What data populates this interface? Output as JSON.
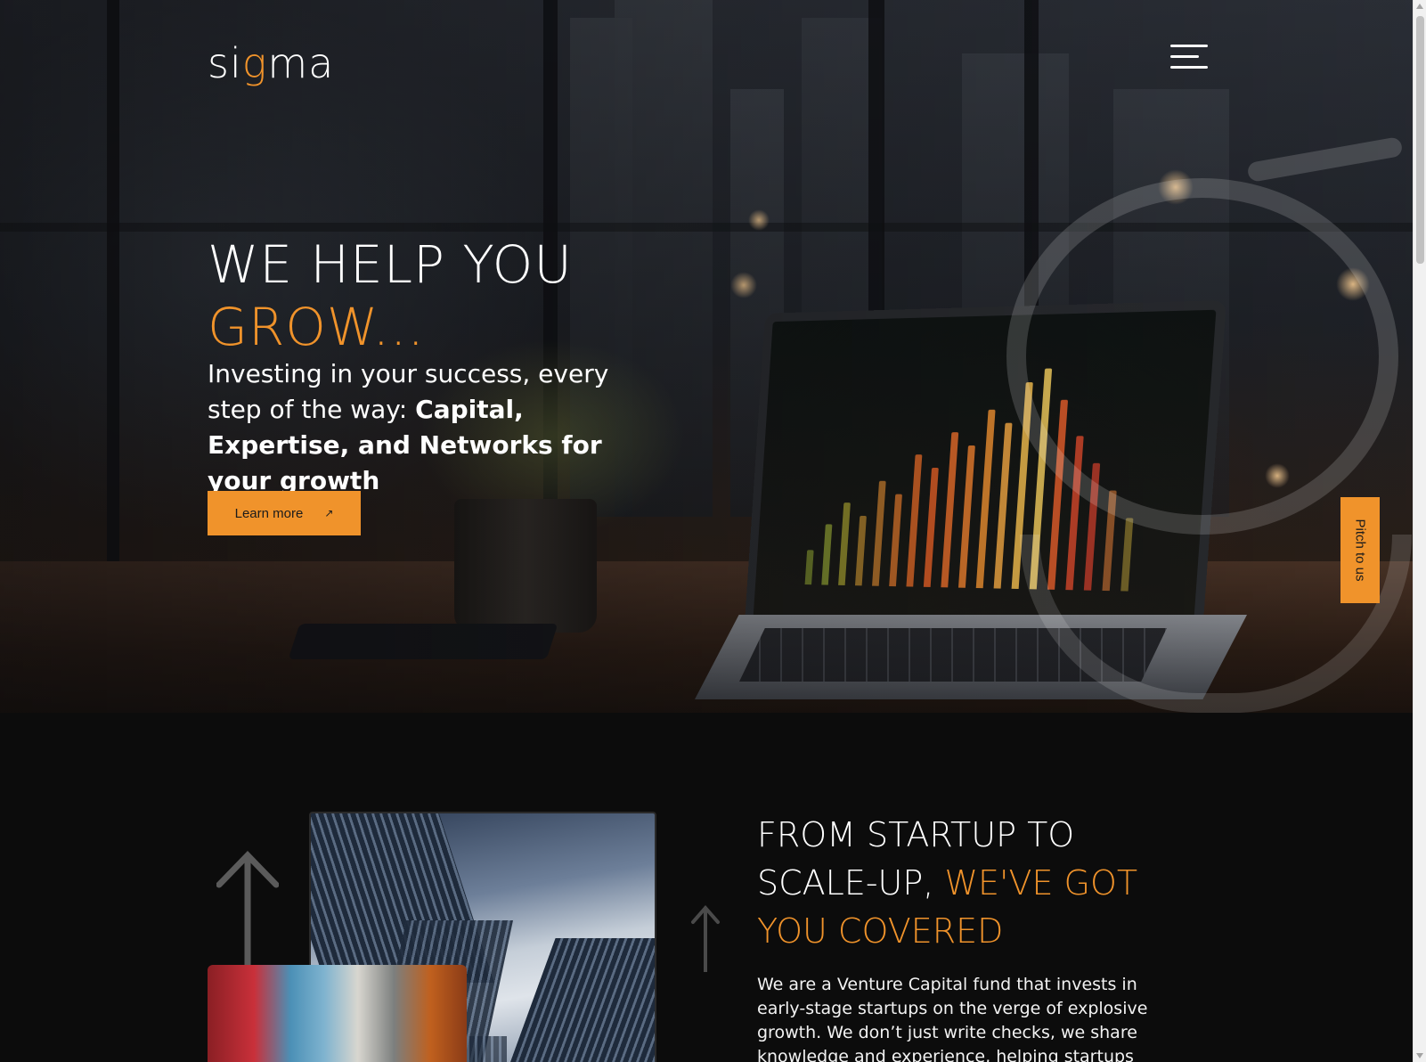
{
  "header": {
    "logo_text_pre": "si",
    "logo_text_accent": "g",
    "logo_text_post": "ma",
    "menu_icon": "hamburger-menu-icon"
  },
  "hero": {
    "title_line1": "WE HELP YOU",
    "title_line2": "GROW...",
    "subtitle_plain": "Investing in your success, every step of the way: ",
    "subtitle_bold": "Capital, Expertise, and Networks for your growth",
    "cta_label": "Learn more",
    "cta_icon": "arrow-up-right-icon",
    "pitch_tab_label": "Pitch to us"
  },
  "about": {
    "title_plain": "FROM STARTUP TO SCALE-UP, ",
    "title_highlight": "WE'VE GOT YOU COVERED",
    "body": "We are a Venture Capital fund that invests in early-stage startups on the verge of explosive growth. We don’t just write checks, we share knowledge and experience, helping startups"
  },
  "colors": {
    "accent": "#f0932b",
    "background": "#0c0c0c",
    "text": "#ffffff"
  }
}
